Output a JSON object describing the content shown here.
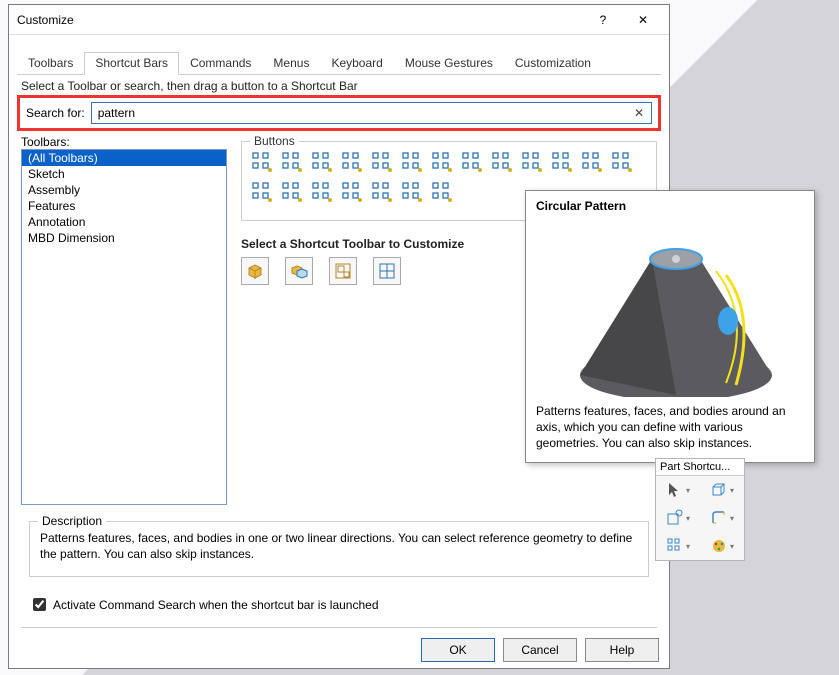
{
  "dialog": {
    "title": "Customize",
    "help_icon": "?",
    "close_icon": "✕"
  },
  "tabs": {
    "items": [
      "Toolbars",
      "Shortcut Bars",
      "Commands",
      "Menus",
      "Keyboard",
      "Mouse Gestures",
      "Customization"
    ],
    "active_index": 1
  },
  "hint": "Select a Toolbar or search, then drag a button to a Shortcut Bar",
  "search": {
    "label": "Search for:",
    "value": "pattern",
    "clear": "✕"
  },
  "left": {
    "label": "Toolbars:",
    "items": [
      "(All Toolbars)",
      "Sketch",
      "Assembly",
      "Features",
      "Annotation",
      "MBD Dimension"
    ],
    "selected_index": 0
  },
  "buttons_group": {
    "legend": "Buttons",
    "count_row1": 13,
    "count_row2": 7
  },
  "shortcut": {
    "label": "Select a Shortcut Toolbar to Customize",
    "icons": [
      "part",
      "assembly",
      "drawing",
      "sketch"
    ]
  },
  "description": {
    "legend": "Description",
    "text": "Patterns features, faces, and bodies in one or two linear directions. You can select reference geometry to define the pattern. You can also skip instances."
  },
  "activate": {
    "checked": true,
    "label": "Activate Command Search when the shortcut bar is launched"
  },
  "footer": {
    "ok": "OK",
    "cancel": "Cancel",
    "help": "Help"
  },
  "tooltip": {
    "title": "Circular Pattern",
    "text": "Patterns features, faces, and bodies around an axis, which you can define with various geometries. You can also skip instances."
  },
  "shortcut_toolbar": {
    "title": "Part Shortcu..."
  }
}
